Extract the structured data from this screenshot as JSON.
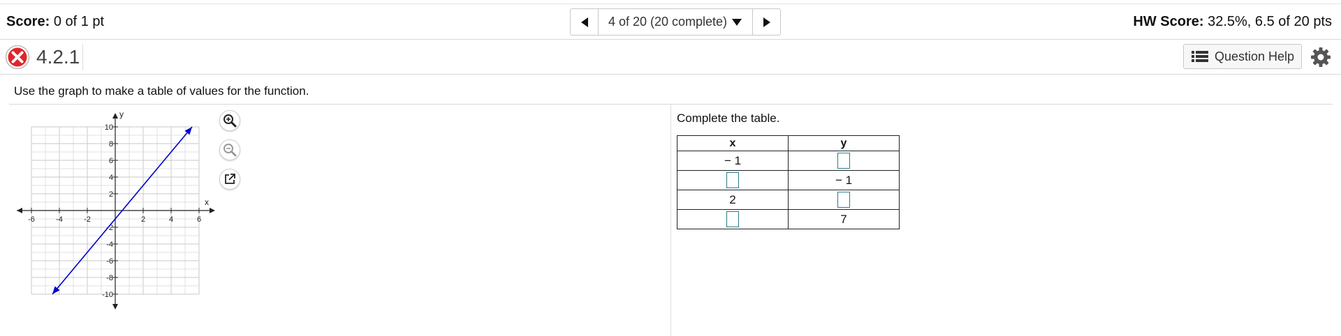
{
  "score_bar": {
    "score_label": "Score:",
    "score_value": "0 of 1 pt",
    "nav_label": "4 of 20 (20 complete)",
    "hw_label": "HW Score:",
    "hw_value": "32.5%, 6.5 of 20 pts"
  },
  "question": {
    "number": "4.2.1",
    "status": "incorrect",
    "help_label": "Question Help",
    "instruction": "Use the graph to make a table of values for the function."
  },
  "graph": {
    "x_axis_label": "x",
    "y_axis_label": "y",
    "x_ticks": [
      "-6",
      "-4",
      "-2",
      "2",
      "4",
      "6"
    ],
    "y_ticks": [
      "10",
      "8",
      "6",
      "4",
      "2",
      "-2",
      "-4",
      "-6",
      "-8",
      "-10"
    ],
    "line_color": "#0000cc",
    "line_points": [
      [
        -4.5,
        -10
      ],
      [
        5.5,
        10
      ]
    ],
    "xlim": [
      -6,
      6
    ],
    "ylim": [
      -10,
      10
    ]
  },
  "table": {
    "prompt": "Complete the table.",
    "headers": [
      "x",
      "y"
    ],
    "rows": [
      {
        "x": "− 1",
        "y": ""
      },
      {
        "x": "",
        "y": "− 1"
      },
      {
        "x": "2",
        "y": ""
      },
      {
        "x": "",
        "y": "7"
      }
    ]
  },
  "colors": {
    "incorrect": "#e0262a",
    "answer_box_border": "#2a7a8a"
  }
}
